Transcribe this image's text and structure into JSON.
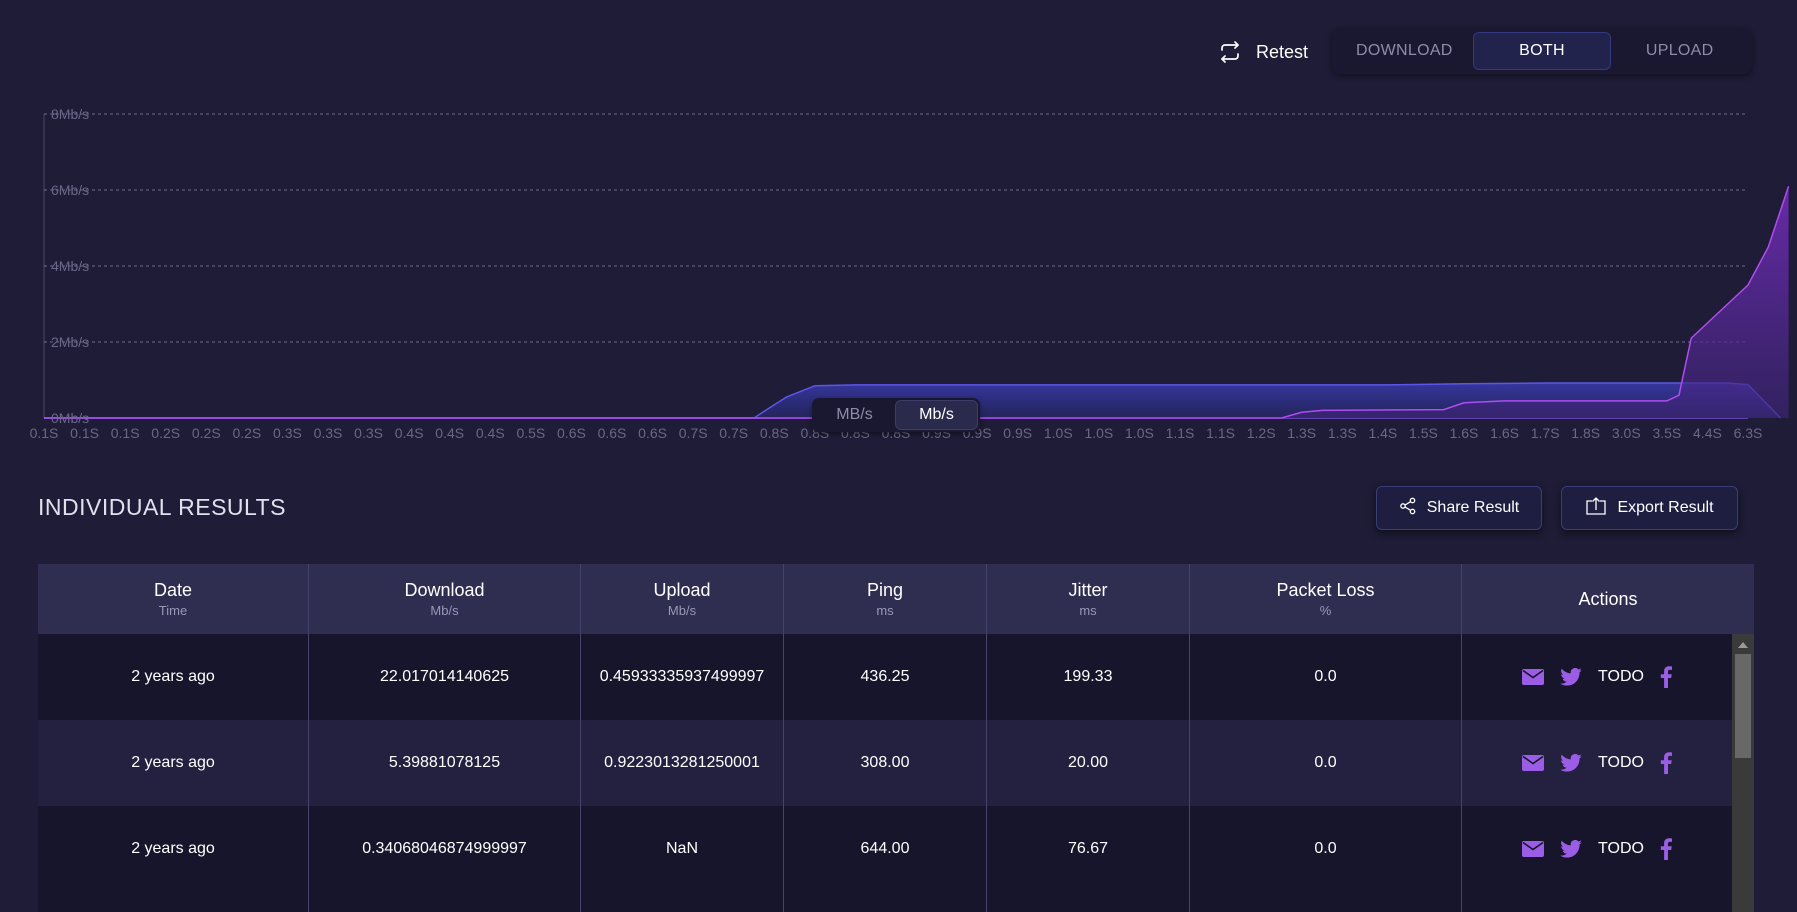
{
  "toolbar": {
    "retest_label": "Retest",
    "modes": [
      "DOWNLOAD",
      "BOTH",
      "UPLOAD"
    ],
    "active_mode": "BOTH"
  },
  "chart_data": {
    "type": "area",
    "y_tick_labels": [
      "0Mb/s",
      "2Mb/s",
      "4Mb/s",
      "6Mb/s",
      "8Mb/s"
    ],
    "ylim": [
      0,
      8
    ],
    "grid": true,
    "x_tick_labels": [
      "0.1S",
      "0.1S",
      "0.1S",
      "0.2S",
      "0.2S",
      "0.2S",
      "0.3S",
      "0.3S",
      "0.3S",
      "0.4S",
      "0.4S",
      "0.4S",
      "0.5S",
      "0.6S",
      "0.6S",
      "0.6S",
      "0.7S",
      "0.7S",
      "0.8S",
      "0.8S",
      "0.8S",
      "0.8S",
      "0.9S",
      "0.9S",
      "0.9S",
      "1.0S",
      "1.0S",
      "1.0S",
      "1.1S",
      "1.1S",
      "1.2S",
      "1.3S",
      "1.3S",
      "1.4S",
      "1.5S",
      "1.6S",
      "1.6S",
      "1.7S",
      "1.8S",
      "3.0S",
      "3.5S",
      "4.4S",
      "6.3S"
    ],
    "series": [
      {
        "color": "#5b56e8",
        "x": [
          0,
          17.5,
          18,
          18.3,
          19,
          20,
          25,
          30,
          33,
          35,
          37,
          40,
          41.5,
          42,
          42.8
        ],
        "y": [
          0,
          0,
          0.35,
          0.55,
          0.85,
          0.87,
          0.87,
          0.87,
          0.87,
          0.9,
          0.92,
          0.92,
          0.92,
          0.88,
          0
        ]
      },
      {
        "color": "#9b3fe0",
        "x": [
          0,
          30.5,
          31,
          31.5,
          34.5,
          35,
          36,
          38,
          40,
          40.3,
          40.6,
          41,
          41.5,
          42,
          42.5,
          43
        ],
        "y": [
          0,
          0,
          0.15,
          0.2,
          0.22,
          0.4,
          0.45,
          0.45,
          0.45,
          0.6,
          2.1,
          2.5,
          3.0,
          3.5,
          4.5,
          6.1
        ]
      }
    ],
    "unit_options": [
      "MB/s",
      "Mb/s"
    ],
    "active_unit": "Mb/s"
  },
  "results": {
    "title": "INDIVIDUAL RESULTS",
    "share_label": "Share Result",
    "export_label": "Export Result",
    "columns": [
      {
        "label": "Date",
        "sub": "Time"
      },
      {
        "label": "Download",
        "sub": "Mb/s"
      },
      {
        "label": "Upload",
        "sub": "Mb/s"
      },
      {
        "label": "Ping",
        "sub": "ms"
      },
      {
        "label": "Jitter",
        "sub": "ms"
      },
      {
        "label": "Packet Loss",
        "sub": "%"
      },
      {
        "label": "Actions",
        "sub": ""
      }
    ],
    "rows": [
      {
        "date": "2 years ago",
        "download": "22.017014140625",
        "upload": "0.45933335937499997",
        "ping": "436.25",
        "jitter": "199.33",
        "loss": "0.0",
        "todo": "TODO"
      },
      {
        "date": "2 years ago",
        "download": "5.39881078125",
        "upload": "0.9223013281250001",
        "ping": "308.00",
        "jitter": "20.00",
        "loss": "0.0",
        "todo": "TODO"
      },
      {
        "date": "2 years ago",
        "download": "0.34068046874999997",
        "upload": "NaN",
        "ping": "644.00",
        "jitter": "76.67",
        "loss": "0.0",
        "todo": "TODO"
      }
    ]
  },
  "colors": {
    "background": "#1e1c36",
    "accent_purple": "#8f4fe0",
    "accent_blue": "#5b56e8",
    "action_icon": "#9b5de5"
  },
  "icons": [
    "retest-icon",
    "share-icon",
    "export-icon",
    "email-icon",
    "twitter-icon",
    "facebook-icon"
  ]
}
